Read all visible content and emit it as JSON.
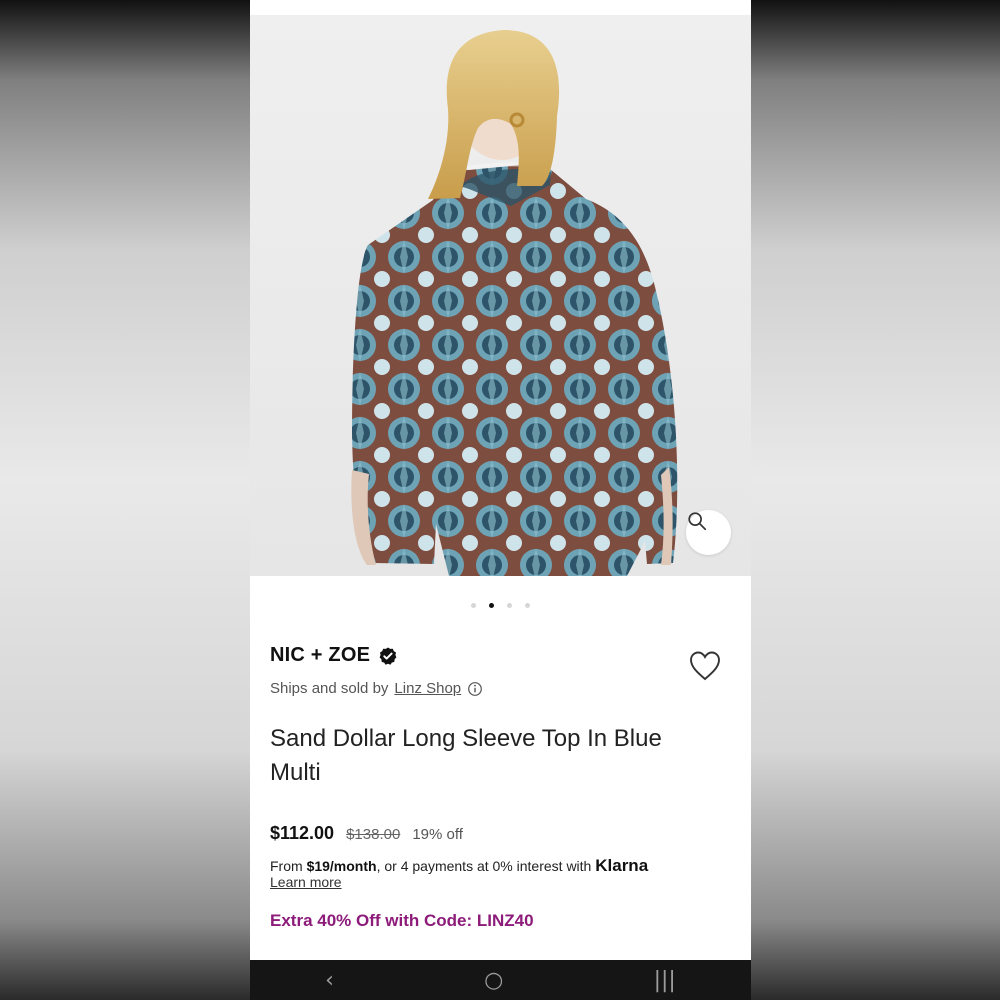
{
  "product": {
    "brand": "NIC + ZOE",
    "ships_prefix": "Ships and sold by",
    "seller": "Linz Shop",
    "title": "Sand Dollar Long Sleeve Top In Blue Multi",
    "price": "$112.00",
    "original_price": "$138.00",
    "discount": "19% off",
    "installment_from": "From",
    "installment_amount": "$19/month",
    "installment_suffix": ", or 4 payments at 0% interest with",
    "installment_provider": "Klarna",
    "learn_more": "Learn more",
    "promo": "Extra 40% Off with Code: LINZ40"
  },
  "carousel": {
    "count": 4,
    "active_index": 1
  },
  "colors": {
    "promo": "#8c1b79",
    "brand_badge": "#111111"
  },
  "icons": {
    "zoom": "magnifier-icon",
    "favorite": "heart-icon",
    "verified": "verified-badge-icon",
    "info": "info-icon",
    "nav_back": "back-icon",
    "nav_home": "home-icon",
    "nav_recents": "recents-icon"
  },
  "nav": {
    "back": "‹",
    "home": "○",
    "recents": "|||"
  }
}
